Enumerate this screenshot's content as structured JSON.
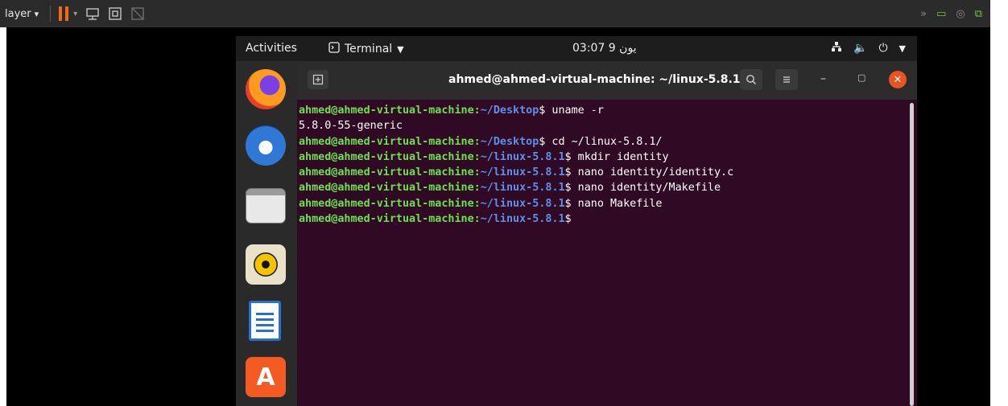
{
  "host_toolbar": {
    "player_label": "layer",
    "dropdown_glyph": "▾"
  },
  "gnome_bar": {
    "activities": "Activities",
    "app_name": "Terminal",
    "clock": "03:07 9 يون",
    "status_icons": [
      "network-icon",
      "volume-icon",
      "power-icon"
    ]
  },
  "dock": {
    "apps": [
      "firefox",
      "thunderbird",
      "files",
      "rhythmbox",
      "libreoffice-writer",
      "ubuntu-software"
    ]
  },
  "terminal": {
    "title": "ahmed@ahmed-virtual-machine: ~/linux-5.8.1",
    "background": "#300a24",
    "prompt_user_color": "#6ee04a",
    "prompt_path_color": "#5f8fe6",
    "lines": [
      {
        "user": "ahmed@ahmed-virtual-machine:",
        "path": "~/Desktop",
        "symbol": "$",
        "cmd": " uname -r"
      },
      {
        "output": "5.8.0-55-generic"
      },
      {
        "user": "ahmed@ahmed-virtual-machine:",
        "path": "~/Desktop",
        "symbol": "$",
        "cmd": " cd ~/linux-5.8.1/"
      },
      {
        "user": "ahmed@ahmed-virtual-machine:",
        "path": "~/linux-5.8.1",
        "symbol": "$",
        "cmd": " mkdir identity"
      },
      {
        "user": "ahmed@ahmed-virtual-machine:",
        "path": "~/linux-5.8.1",
        "symbol": "$",
        "cmd": " nano identity/identity.c"
      },
      {
        "user": "ahmed@ahmed-virtual-machine:",
        "path": "~/linux-5.8.1",
        "symbol": "$",
        "cmd": " nano identity/Makefile"
      },
      {
        "user": "ahmed@ahmed-virtual-machine:",
        "path": "~/linux-5.8.1",
        "symbol": "$",
        "cmd": " nano Makefile"
      },
      {
        "user": "ahmed@ahmed-virtual-machine:",
        "path": "~/linux-5.8.1",
        "symbol": "$",
        "cmd": ""
      }
    ]
  }
}
